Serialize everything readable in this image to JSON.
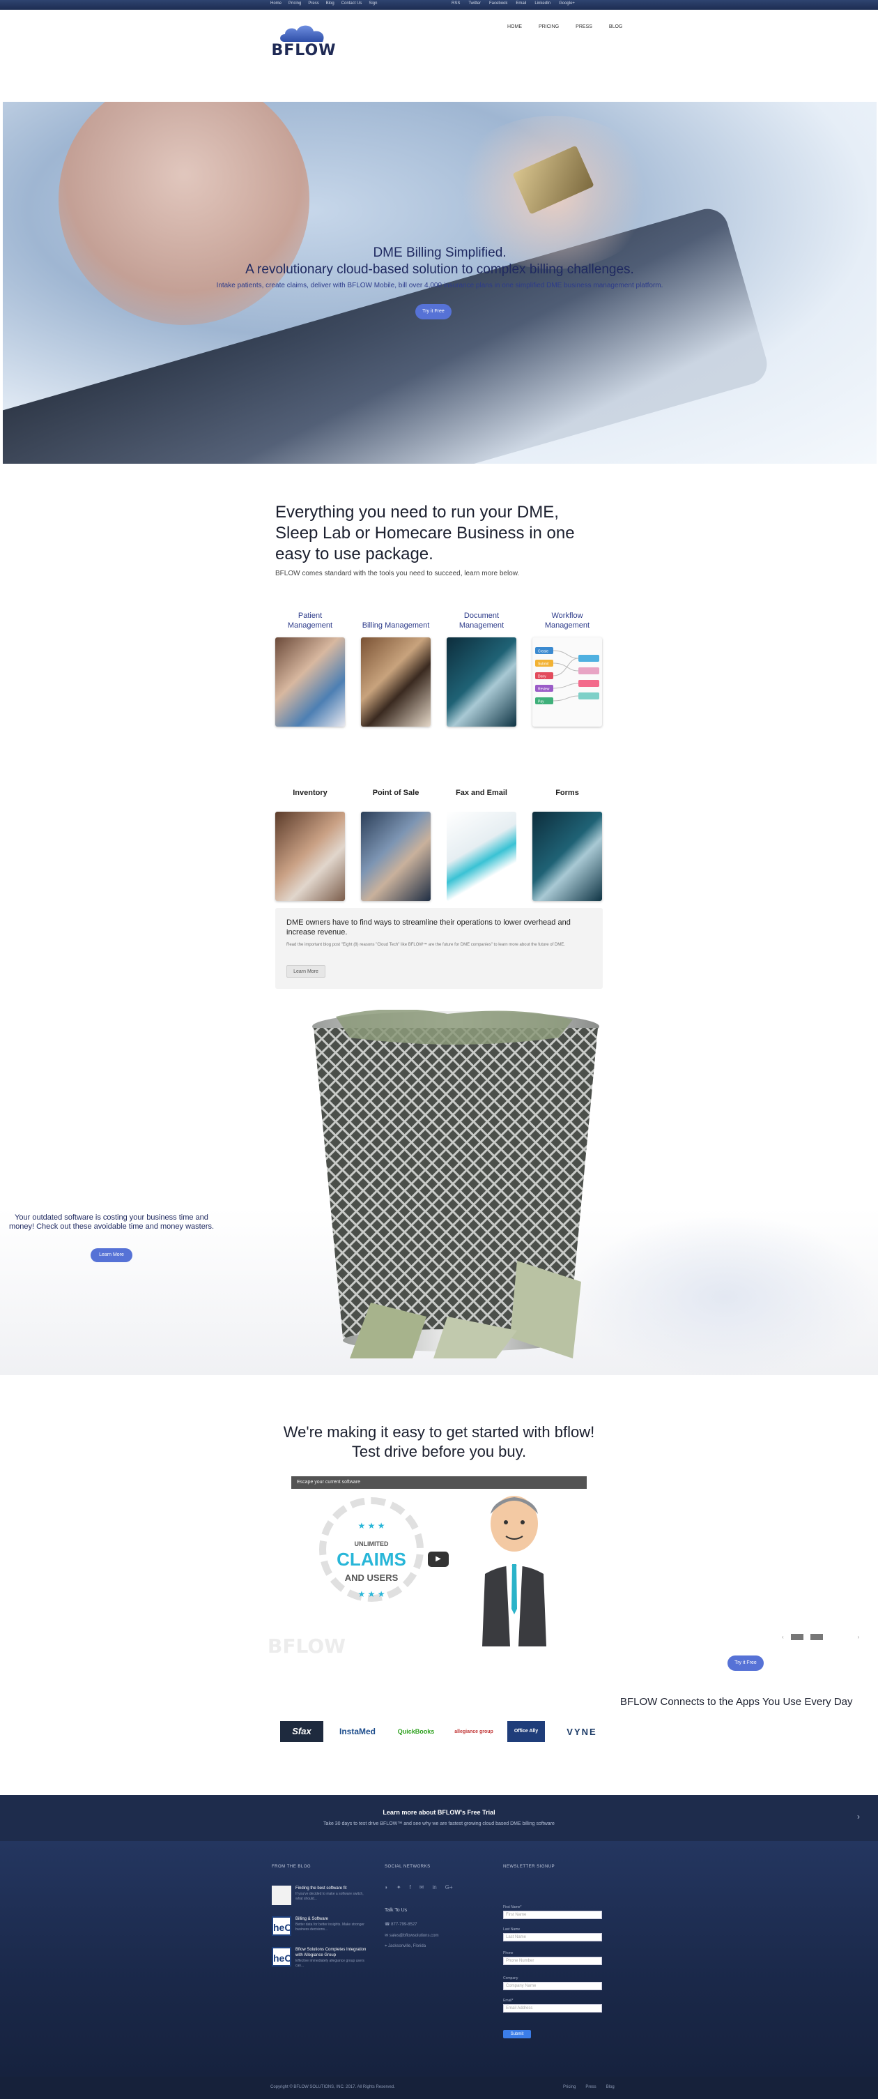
{
  "topbar": {
    "links": [
      "Home",
      "Pricing",
      "Press",
      "Blog",
      "Contact Us",
      "Sign"
    ],
    "social": [
      "RSS",
      "Twitter",
      "Facebook",
      "Email",
      "LinkedIn",
      "Google+"
    ]
  },
  "header": {
    "logo": "BFLOW",
    "nav": [
      "HOME",
      "PRICING",
      "PRESS",
      "BLOG"
    ]
  },
  "hero": {
    "line1": "DME Billing Simplified.",
    "line2": "A revolutionary cloud-based solution to complex billing challenges.",
    "line3": "Intake patients, create claims, deliver with BFLOW Mobile, bill over 4,000 insurance plans in one simplified DME business management platform.",
    "cta": "Try it Free"
  },
  "features": {
    "heading": "Everything you need to run your DME, Sleep Lab or Homecare Business in one easy to use package.",
    "sub": "BFLOW comes standard with the tools you need to succeed, learn more below.",
    "row1": [
      {
        "label": "Patient Management"
      },
      {
        "label": "Billing Management"
      },
      {
        "label": "Document Management"
      },
      {
        "label": "Workflow Management"
      }
    ],
    "row2": [
      {
        "label": "Inventory"
      },
      {
        "label": "Point of Sale"
      },
      {
        "label": "Fax and Email"
      },
      {
        "label": "Forms"
      }
    ],
    "workflow_tags": [
      "Create",
      "Submit",
      "Deny",
      "Review",
      "Pay"
    ]
  },
  "dme_box": {
    "heading": "DME owners have to find ways to streamline their operations to lower overhead and increase revenue.",
    "para": "Read the important blog post \"Eight (8) reasons \"Cloud Tech\" like BFLOW™ are the future for DME companies\" to learn more about the future of DME.",
    "button": "Learn More"
  },
  "waste": {
    "message": "Your outdated software is costing your business time and money! Check out these avoidable time and money wasters.",
    "button": "Learn More"
  },
  "testdrive": {
    "heading": "We're making it easy to get started with bflow! Test drive before you buy.",
    "video_title": "Escape your current software",
    "unlimited": "UNLIMITED",
    "claims": "CLAIMS",
    "and_users": "AND USERS",
    "stars": "★ ★ ★",
    "watermark": "BFLOW",
    "cta": "Try it Free"
  },
  "apps": {
    "heading": "BFLOW Connects to the Apps You Use Every Day",
    "logos": [
      "Sfax",
      "InstaMed",
      "QuickBooks",
      "allegiance group",
      "Office Ally",
      "VYNE"
    ]
  },
  "trial": {
    "title": "Learn more about BFLOW's Free Trial",
    "text": "Take 30 days to test drive BFLOW™ and see why we are fastest growing cloud based DME billing software"
  },
  "footer": {
    "blog_heading": "FROM THE BLOG",
    "social_heading": "SOCIAL NETWORKS",
    "newsletter_heading": "NEWSLETTER SIGNUP",
    "posts": [
      {
        "title": "Finding the best software fit",
        "excerpt": "If you've decided to make a software switch, what should..."
      },
      {
        "title": "Billing & Software",
        "excerpt": "Better data for better insights. Make stronger business decisions..."
      },
      {
        "title": "Bflow Solutions Completes Integration with Allegiance Group",
        "excerpt": "Effective immediately allegiance group users can..."
      }
    ],
    "social_icons": [
      "rss-icon",
      "twitter-icon",
      "facebook-icon",
      "email-icon",
      "linkedin-icon",
      "googleplus-icon"
    ],
    "social_glyphs": [
      "◗",
      "✦",
      "f",
      "✉",
      "in",
      "G+"
    ],
    "talk": "Talk To Us",
    "phone": "☎  877-799-8527",
    "email": "✉  sales@bflowsolutions.com",
    "address": "⌖  Jacksonville, Florida",
    "newsletter": [
      {
        "label": "First Name*",
        "placeholder": "First Name"
      },
      {
        "label": "Last Name",
        "placeholder": "Last Name"
      },
      {
        "label": "Phone",
        "placeholder": "Phone Number"
      },
      {
        "label": "Company",
        "placeholder": "Company Name"
      },
      {
        "label": "Email*",
        "placeholder": "Email Address"
      }
    ],
    "submit": "Submit",
    "copyright": "Copyright © BFLOW SOLUTIONS, INC. 2017. All Rights Reserved.",
    "bottom_links": [
      "Pricing",
      "Press",
      "Blog"
    ]
  }
}
